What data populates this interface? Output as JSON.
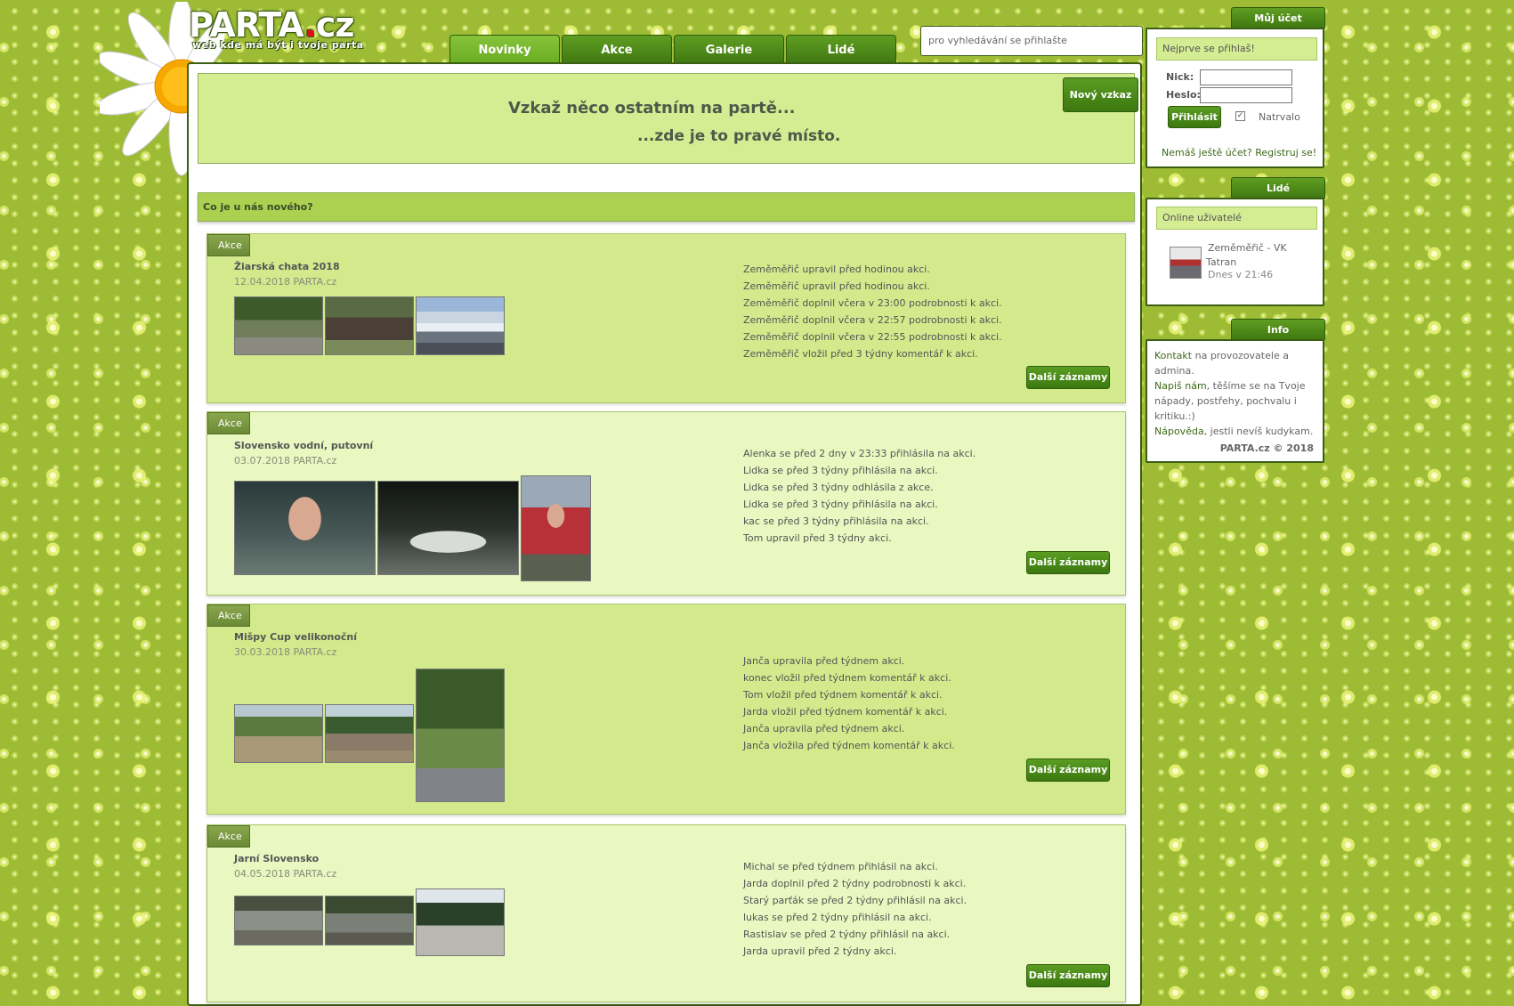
{
  "logo": {
    "title_main": "PARTA",
    "title_dot": ".",
    "title_tld": "cz",
    "tagline": "web kde má být i tvoje parta"
  },
  "tabs": [
    {
      "label": "Novinky",
      "active": true
    },
    {
      "label": "Akce",
      "active": false
    },
    {
      "label": "Galerie",
      "active": false
    },
    {
      "label": "Lidé",
      "active": false
    }
  ],
  "search": {
    "placeholder": "pro vyhledávání se přihlašte"
  },
  "message_box": {
    "line1": "Vzkaž něco ostatním na partě...",
    "line2": "...zde je to pravé místo.",
    "new_button": "Nový vzkaz"
  },
  "news_header": "Co je u nás nového?",
  "cards": [
    {
      "tag": "Akce",
      "title": "Žiarská chata 2018",
      "date": "12.04.2018 PARTA.cz",
      "log": [
        "Zeměměřič upravil před hodinou akci.",
        "Zeměměřič upravil před hodinou akci.",
        "Zeměměřič doplnil včera v 23:00 podrobnosti k akci.",
        "Zeměměřič doplnil včera v 22:57 podrobnosti k akci.",
        "Zeměměřič doplnil včera v 22:55 podrobnosti k akci.",
        "Zeměměřič vložil před 3 týdny komentář k akci."
      ],
      "more": "Další záznamy"
    },
    {
      "tag": "Akce",
      "title": "Slovensko vodní, putovní",
      "date": "03.07.2018 PARTA.cz",
      "log": [
        "Alenka se před 2 dny v 23:33 přihlásila na akci.",
        "Lidka se před 3 týdny přihlásila na akci.",
        "Lidka se před 3 týdny odhlásila z akce.",
        "Lidka se před 3 týdny přihlásila na akci.",
        "kac se před 3 týdny přihlásila na akci.",
        "Tom upravil před 3 týdny akci."
      ],
      "more": "Další záznamy"
    },
    {
      "tag": "Akce",
      "title": "Mišpy Cup velikonoční",
      "date": "30.03.2018 PARTA.cz",
      "log": [
        "Janča upravila před týdnem akci.",
        "konec vložil před týdnem komentář k akci.",
        "Tom vložil před týdnem komentář k akci.",
        "Jarda vložil před týdnem komentář k akci.",
        "Janča upravila před týdnem akci.",
        "Janča vložila před týdnem komentář k akci."
      ],
      "more": "Další záznamy"
    },
    {
      "tag": "Akce",
      "title": "Jarní Slovensko",
      "date": "04.05.2018 PARTA.cz",
      "log": [
        "Michal se před týdnem přihlásil na akci.",
        "Jarda doplnil před 2 týdny podrobnosti k akci.",
        "Starý parťák se před 2 týdny přihlásil na akci.",
        "lukas se před 2 týdny přihlásil na akci.",
        "Rastislav se před 2 týdny přihlásil na akci.",
        "Jarda upravil před 2 týdny akci."
      ],
      "more": "Další záznamy"
    }
  ],
  "account": {
    "header": "Můj účet",
    "bar": "Nejprve se přihlaš!",
    "nick_label": "Nick:",
    "pass_label": "Heslo:",
    "login_button": "Přihlásit",
    "remember_label": "Natrvalo",
    "register_text": "Nemáš ještě účet? Registruj se!"
  },
  "people": {
    "header": "Lidé",
    "bar": "Online uživatelé",
    "user_name_line1": "Zeměměřič - VK",
    "user_name_line2": "Tatran",
    "user_time": "Dnes v 21:46"
  },
  "info": {
    "header": "Info",
    "kontakt_link": "Kontakt",
    "kontakt_text": " na provozovatele a admina.",
    "napis_link": "Napiš nám",
    "napis_text": ", těšíme se na Tvoje nápady, postřehy, pochvalu i kritiku.:)",
    "napoveda_link": "Nápověda",
    "napoveda_text": ", jestli nevíš kudykam.",
    "copyright": "PARTA.cz © 2018"
  },
  "colors": {
    "accent": "#3f7710",
    "panel": "#d4ec92",
    "card_light": "#e8f8c0",
    "background": "#9dbb35"
  }
}
